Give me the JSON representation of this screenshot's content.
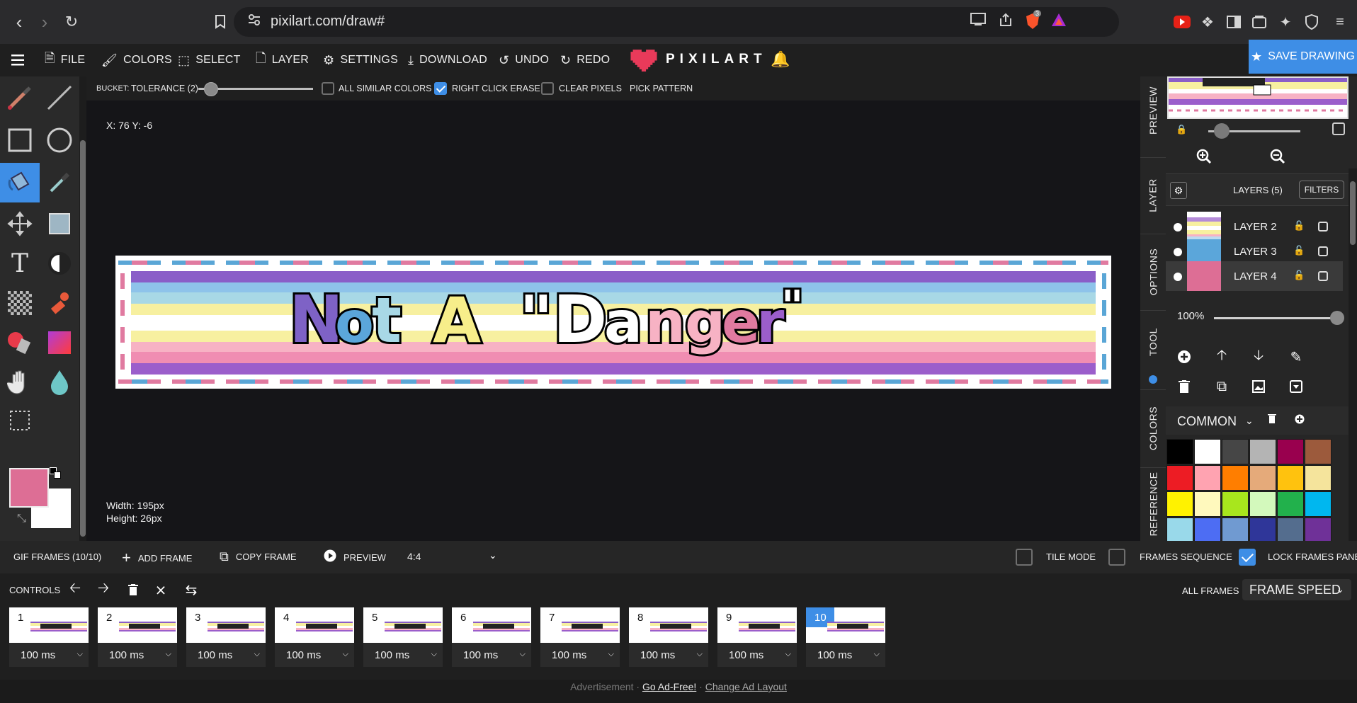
{
  "browser": {
    "url": "pixilart.com/draw#",
    "badge_count": "3"
  },
  "menu": {
    "file": "FILE",
    "colors": "COLORS",
    "select": "SELECT",
    "layer": "LAYER",
    "settings": "SETTINGS",
    "download": "DOWNLOAD",
    "undo": "UNDO",
    "redo": "REDO",
    "logo": "PIXILART",
    "save": "SAVE DRAWING"
  },
  "tool_options": {
    "bucket_label": "BUCKET:",
    "tolerance_label": "TOLERANCE (2)",
    "tolerance_value": 2,
    "all_similar_colors": "ALL SIMILAR COLORS",
    "all_similar_colors_checked": false,
    "right_click_erase": "RIGHT CLICK ERASE",
    "right_click_erase_checked": true,
    "clear_pixels": "CLEAR PIXELS",
    "clear_pixels_checked": false,
    "pick_pattern": "PICK PATTERN"
  },
  "canvas": {
    "coords": "X: 76 Y: -6",
    "width": "Width: 195px",
    "height": "Height: 26px",
    "artwork_text": "Not A \"Danger\""
  },
  "toolbar": {
    "active_tool": "bucket-tool",
    "primary_color": "#dd6e95",
    "secondary_color": "#ffffff"
  },
  "side_tabs": [
    "PREVIEW",
    "LAYER",
    "OPTIONS",
    "TOOL",
    "COLORS",
    "REFERENCE"
  ],
  "layers": {
    "title": "LAYERS (5)",
    "filters": "FILTERS",
    "items": [
      {
        "name": "LAYER 2",
        "active": false
      },
      {
        "name": "LAYER 3",
        "active": false
      },
      {
        "name": "LAYER 4",
        "active": true
      }
    ],
    "opacity": "100%"
  },
  "palette": {
    "name": "COMMON",
    "colors": [
      "#000000",
      "#ffffff",
      "#464646",
      "#b4b4b4",
      "#99004e",
      "#9c5a3c",
      "#ed1c24",
      "#ffa3b1",
      "#ff7e00",
      "#e5aa7a",
      "#ffc20e",
      "#f5e49c",
      "#fff200",
      "#fff9bd",
      "#a8e61d",
      "#d3f9bc",
      "#22b14c",
      "#00b7ef",
      "#99d9ea",
      "#4d6df3",
      "#709ad1",
      "#2f3699",
      "#546d8e",
      "#6f3198"
    ]
  },
  "frames_bar": {
    "gif_frames": "GIF FRAMES (10/10)",
    "add_frame": "ADD FRAME",
    "copy_frame": "COPY FRAME",
    "preview": "PREVIEW",
    "ratio": "4:4",
    "tile_mode": "TILE MODE",
    "frames_sequence": "FRAMES SEQUENCE",
    "lock_frames_panel": "LOCK FRAMES PANEL",
    "lock_checked": true
  },
  "controls": {
    "label": "CONTROLS",
    "all_frames": "ALL FRAMES",
    "frame_speed": "FRAME SPEED",
    "frames": [
      {
        "num": "1",
        "speed": "100 ms",
        "current": false
      },
      {
        "num": "2",
        "speed": "100 ms",
        "current": false
      },
      {
        "num": "3",
        "speed": "100 ms",
        "current": false
      },
      {
        "num": "4",
        "speed": "100 ms",
        "current": false
      },
      {
        "num": "5",
        "speed": "100 ms",
        "current": false
      },
      {
        "num": "6",
        "speed": "100 ms",
        "current": false
      },
      {
        "num": "7",
        "speed": "100 ms",
        "current": false
      },
      {
        "num": "8",
        "speed": "100 ms",
        "current": false
      },
      {
        "num": "9",
        "speed": "100 ms",
        "current": false
      },
      {
        "num": "10",
        "speed": "100 ms",
        "current": true
      }
    ]
  },
  "footer": {
    "advertisement": "Advertisement ·",
    "go_ad_free": "Go Ad-Free!",
    "separator": " · ",
    "change_layout": "Change Ad Layout"
  }
}
